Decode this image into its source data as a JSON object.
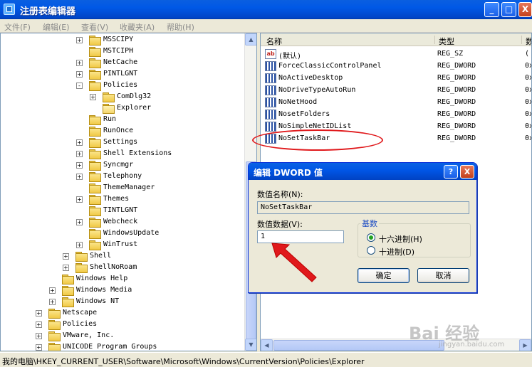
{
  "window": {
    "title": "注册表编辑器",
    "controls": {
      "minimize": "_",
      "maximize": "□",
      "close": "X"
    }
  },
  "menu": [
    "文件(F)",
    "编辑(E)",
    "查看(V)",
    "收藏夹(A)",
    "帮助(H)"
  ],
  "tree": {
    "items": [
      {
        "label": "MSSCIPY",
        "expander": "+"
      },
      {
        "label": "MSTCIPH",
        "expander": ""
      },
      {
        "label": "NetCache",
        "expander": "+"
      },
      {
        "label": "PINTLGNT",
        "expander": "+"
      },
      {
        "label": "Policies",
        "expander": "-"
      },
      {
        "label": "ComDlg32",
        "expander": "+"
      },
      {
        "label": "Explorer",
        "expander": ""
      },
      {
        "label": "Run",
        "expander": ""
      },
      {
        "label": "RunOnce",
        "expander": ""
      },
      {
        "label": "Settings",
        "expander": "+"
      },
      {
        "label": "Shell Extensions",
        "expander": "+"
      },
      {
        "label": "Syncmgr",
        "expander": "+"
      },
      {
        "label": "Telephony",
        "expander": "+"
      },
      {
        "label": "ThemeManager",
        "expander": ""
      },
      {
        "label": "Themes",
        "expander": "+"
      },
      {
        "label": "TINTLGNT",
        "expander": ""
      },
      {
        "label": "Webcheck",
        "expander": "+"
      },
      {
        "label": "WindowsUpdate",
        "expander": ""
      },
      {
        "label": "WinTrust",
        "expander": "+"
      },
      {
        "label": "Shell",
        "expander": "+"
      },
      {
        "label": "ShellNoRoam",
        "expander": "+"
      },
      {
        "label": "Windows Help",
        "expander": ""
      },
      {
        "label": "Windows Media",
        "expander": "+"
      },
      {
        "label": "Windows NT",
        "expander": "+"
      },
      {
        "label": "Netscape",
        "expander": "+"
      },
      {
        "label": "Policies",
        "expander": "+"
      },
      {
        "label": "VMware, Inc.",
        "expander": "+"
      },
      {
        "label": "UNICODE Program Groups",
        "expander": "+"
      }
    ]
  },
  "list": {
    "headers": {
      "name": "名称",
      "type": "类型",
      "data": "数"
    },
    "rows": [
      {
        "name": "(默认)",
        "type": "REG_SZ",
        "data": "(",
        "icon": "string-value-icon"
      },
      {
        "name": "ForceClassicControlPanel",
        "type": "REG_DWORD",
        "data": "0x",
        "icon": "dword-value-icon"
      },
      {
        "name": "NoActiveDesktop",
        "type": "REG_DWORD",
        "data": "0x",
        "icon": "dword-value-icon"
      },
      {
        "name": "NoDriveTypeAutoRun",
        "type": "REG_DWORD",
        "data": "0x",
        "icon": "dword-value-icon"
      },
      {
        "name": "NoNetHood",
        "type": "REG_DWORD",
        "data": "0x",
        "icon": "dword-value-icon"
      },
      {
        "name": "NosetFolders",
        "type": "REG_DWORD",
        "data": "0x",
        "icon": "dword-value-icon"
      },
      {
        "name": "NoSimpleNetIDList",
        "type": "REG_DWORD",
        "data": "0x",
        "icon": "dword-value-icon"
      },
      {
        "name": "NoSetTaskBar",
        "type": "REG_DWORD",
        "data": "0x",
        "icon": "dword-value-icon"
      }
    ],
    "string_icon_text": "ab"
  },
  "status": {
    "path": "我的电脑\\HKEY_CURRENT_USER\\Software\\Microsoft\\Windows\\CurrentVersion\\Policies\\Explorer"
  },
  "dialog": {
    "title": "编辑 DWORD 值",
    "help": "?",
    "close": "X",
    "name_label": "数值名称(N):",
    "name_value": "NoSetTaskBar",
    "data_label": "数值数据(V):",
    "data_value": "1",
    "base_label": "基数",
    "hex_label": "十六进制(H)",
    "dec_label": "十进制(D)",
    "selected_base": "hex",
    "ok": "确定",
    "cancel": "取消"
  },
  "watermark": {
    "text": "Bai 经验",
    "url": "jingyan.baidu.com"
  },
  "colors": {
    "annotation": "#e0191c",
    "titlebar": "#0055e5"
  }
}
